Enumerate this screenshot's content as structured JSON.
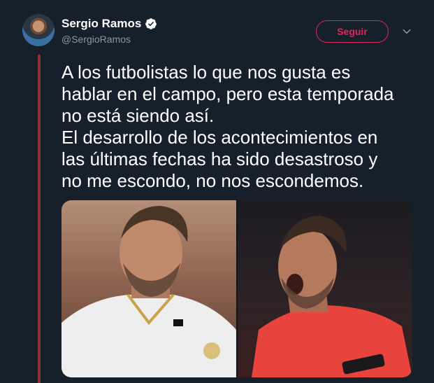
{
  "tweet": {
    "author": {
      "name": "Sergio Ramos",
      "handle": "@SergioRamos",
      "verified": true,
      "avatar_icon": "profile-photo"
    },
    "follow_label": "Seguir",
    "menu_icon": "chevron-down-icon",
    "text_lines": [
      "A los futbolistas lo que nos gusta es",
      "hablar en el campo, pero esta temporada",
      "no está siendo así.",
      "El desarrollo de los acontecimientos en",
      "las últimas fechas ha sido desastroso y",
      "no me escondo, no nos escondemos."
    ],
    "media": {
      "count": 2,
      "photos": [
        "player-white-kit-photo",
        "player-red-kit-photo"
      ]
    }
  },
  "colors": {
    "background": "#15202b",
    "accent": "#e0245e",
    "thread_line": "#8b2f36",
    "secondary_text": "#8899a6",
    "verified": "#ffffff"
  }
}
